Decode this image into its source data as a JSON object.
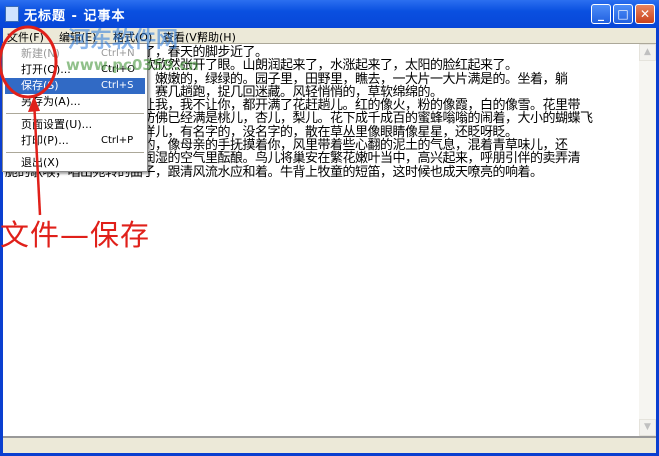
{
  "window": {
    "title": "无标题 - 记事本",
    "minimize_icon": "minimize-icon",
    "maximize_icon": "maximize-icon",
    "close_icon": "close-icon"
  },
  "menubar": [
    "文件(F)",
    "编辑(E)",
    "格式(O)",
    "查看(V)",
    "帮助(H)"
  ],
  "file_menu": {
    "items": [
      {
        "label": "新建(N)",
        "shortcut": "Ctrl+N"
      },
      {
        "label": "打开(O)...",
        "shortcut": "Ctrl+O"
      },
      {
        "label": "保存(S)",
        "shortcut": "Ctrl+S",
        "highlighted": true
      },
      {
        "label": "另存为(A)...",
        "shortcut": ""
      },
      {
        "label": "页面设置(U)...",
        "shortcut": ""
      },
      {
        "label": "打印(P)...",
        "shortcut": "Ctrl+P"
      },
      {
        "label": "退出(X)",
        "shortcut": ""
      }
    ]
  },
  "editor": {
    "lines": [
      "盼望着，盼望着，东风来了，春天的脚步近了。",
      "一切都像刚睡醒的样子，欣欣然张开了眼。山朗润起来了，水涨起来了，太阳的脸红起来了。",
      "小草偷偷地从土里钻出来，嫩嫩的，绿绿的。园子里，田野里，瞧去，一大片一大片满是的。坐着，躺",
      "着，打两个滚，踢几脚球，赛几趟跑，捉几回迷藏。风轻悄悄的，草软绵绵的。",
      "桃树、杏树、梨树，你不让我，我不让你，都开满了花赶趟儿。红的像火，粉的像霞，白的像雪。花里带",
      "着甜味儿；闭了眼，树上仿佛已经满是桃儿，杏儿，梨儿。花下成千成百的蜜蜂嗡嗡的闹着，大小的蝴蝶飞",
      "来飞去。野花遍地是：杂样儿，有名字的，没名字的，散在草丛里像眼睛像星星，还眨呀眨。",
      "“吹面不寒杨柳风”，不错的，像母亲的手抚摸着你，风里带着些心翻的泥土的气息，混着青草味儿，还",
      "有各种花的香，都在微微润湿的空气里酝酿。鸟儿将巢安在繁花嫩叶当中，高兴起来，呼朋引伴的卖弄清",
      "脆的歌喉，唱出宛转的曲子，跟清风流水应和着。牛背上牧童的短笛，这时候也成天嘹亮的响着。"
    ]
  },
  "annotation": {
    "text": "文件—保存",
    "color": "#e0201a"
  },
  "watermark": {
    "name": "河东软件网",
    "url": "www.pc0359.cn"
  }
}
